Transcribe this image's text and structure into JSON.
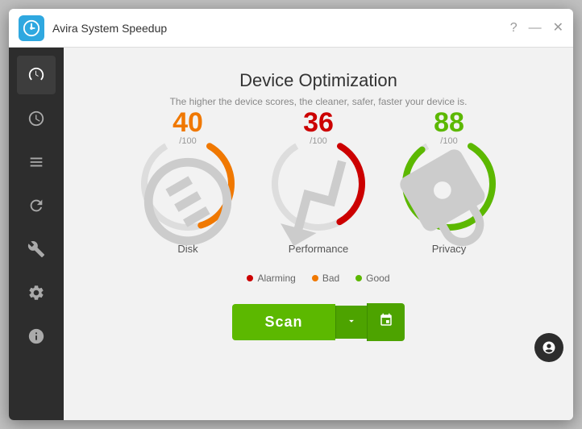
{
  "window": {
    "title": "Avira System Speedup",
    "controls": {
      "help": "?",
      "minimize": "—",
      "close": "✕"
    }
  },
  "sidebar": {
    "items": [
      {
        "id": "speedometer",
        "label": "Speedometer"
      },
      {
        "id": "clock",
        "label": "Clock"
      },
      {
        "id": "list",
        "label": "List"
      },
      {
        "id": "refresh",
        "label": "Refresh"
      },
      {
        "id": "tools",
        "label": "Tools"
      },
      {
        "id": "settings",
        "label": "Settings"
      },
      {
        "id": "info",
        "label": "Info"
      }
    ]
  },
  "page": {
    "title": "Device Optimization",
    "subtitle": "The higher the device scores, the cleaner, safer, faster your device is."
  },
  "gauges": [
    {
      "id": "disk",
      "value": 40,
      "max": 100,
      "label": "Disk",
      "color": "#f07800",
      "status": "bad",
      "icon": "💾",
      "percent": 44
    },
    {
      "id": "performance",
      "value": 36,
      "max": 100,
      "label": "Performance",
      "color": "#cc0000",
      "status": "alarming",
      "icon": "📈",
      "percent": 40
    },
    {
      "id": "privacy",
      "value": 88,
      "max": 100,
      "label": "Privacy",
      "color": "#5cb800",
      "status": "good",
      "icon": "🔒",
      "percent": 97
    }
  ],
  "legend": [
    {
      "label": "Alarming",
      "color": "#cc0000"
    },
    {
      "label": "Bad",
      "color": "#f07800"
    },
    {
      "label": "Good",
      "color": "#5cb800"
    }
  ],
  "scan_button": {
    "label": "Scan",
    "dropdown_aria": "Dropdown",
    "calendar_aria": "Schedule"
  }
}
